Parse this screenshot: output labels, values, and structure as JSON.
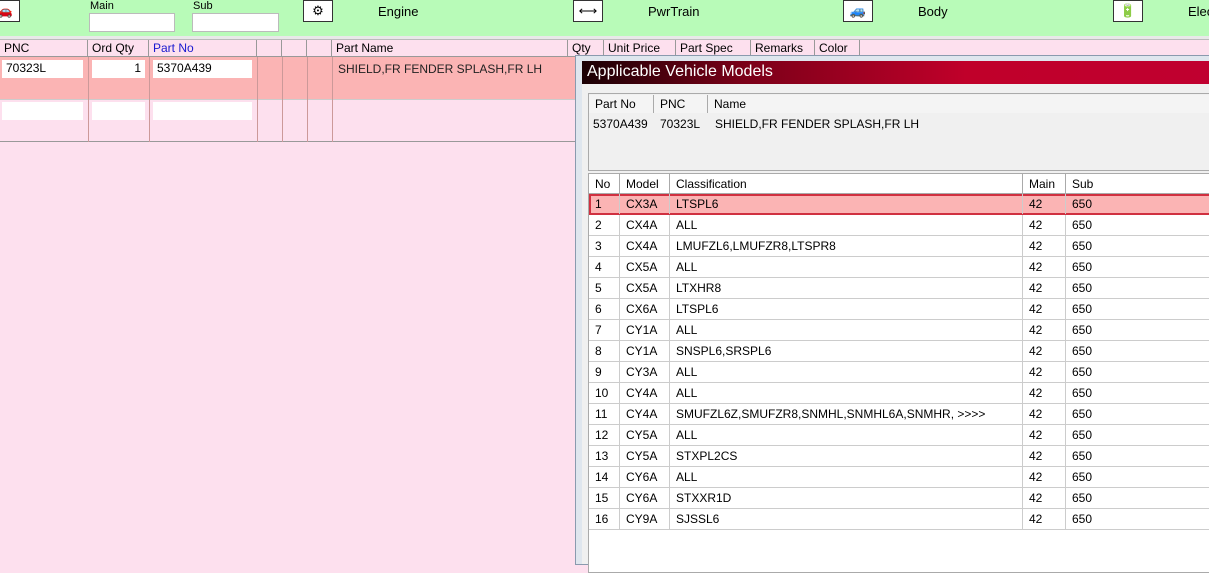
{
  "toolbar": {
    "main_label": "Main",
    "sub_label": "Sub",
    "main_value": "",
    "sub_value": "",
    "categories": [
      {
        "label": "Engine",
        "icon": "engine-icon"
      },
      {
        "label": "PwrTrain",
        "icon": "powertrain-icon"
      },
      {
        "label": "Body",
        "icon": "body-icon"
      },
      {
        "label": "Elec",
        "icon": "battery-icon"
      }
    ]
  },
  "grid": {
    "headers": [
      "PNC",
      "Ord Qty",
      "Part No",
      "",
      "",
      "",
      "Part Name",
      "Qty",
      "Unit Price",
      "Part Spec",
      "Remarks",
      "Color"
    ],
    "partno_header_color": "#1a1ad0",
    "rows": [
      {
        "pnc": "70323L",
        "ord_qty": "1",
        "part_no": "5370A439",
        "part_name": "SHIELD,FR FENDER SPLASH,FR LH"
      }
    ]
  },
  "dialog": {
    "title": "Applicable Vehicle Models",
    "part_headers": [
      "Part No",
      "PNC",
      "Name"
    ],
    "part": {
      "part_no": "5370A439",
      "pnc": "70323L",
      "name": "SHIELD,FR FENDER SPLASH,FR LH"
    },
    "list_headers": [
      "No",
      "Model",
      "Classification",
      "Main",
      "Sub"
    ],
    "selected_index": 0,
    "rows": [
      [
        "1",
        "CX3A",
        "LTSPL6",
        "42",
        "650"
      ],
      [
        "2",
        "CX4A",
        "ALL",
        "42",
        "650"
      ],
      [
        "3",
        "CX4A",
        "LMUFZL6,LMUFZR8,LTSPR8",
        "42",
        "650"
      ],
      [
        "4",
        "CX5A",
        "ALL",
        "42",
        "650"
      ],
      [
        "5",
        "CX5A",
        "LTXHR8",
        "42",
        "650"
      ],
      [
        "6",
        "CX6A",
        "LTSPL6",
        "42",
        "650"
      ],
      [
        "7",
        "CY1A",
        "ALL",
        "42",
        "650"
      ],
      [
        "8",
        "CY1A",
        "SNSPL6,SRSPL6",
        "42",
        "650"
      ],
      [
        "9",
        "CY3A",
        "ALL",
        "42",
        "650"
      ],
      [
        "10",
        "CY4A",
        "ALL",
        "42",
        "650"
      ],
      [
        "11",
        "CY4A",
        "SMUFZL6Z,SMUFZR8,SNMHL,SNMHL6A,SNMHR,  >>>>",
        "42",
        "650"
      ],
      [
        "12",
        "CY5A",
        "ALL",
        "42",
        "650"
      ],
      [
        "13",
        "CY5A",
        "STXPL2CS",
        "42",
        "650"
      ],
      [
        "14",
        "CY6A",
        "ALL",
        "42",
        "650"
      ],
      [
        "15",
        "CY6A",
        "STXXR1D",
        "42",
        "650"
      ],
      [
        "16",
        "CY9A",
        "SJSSL6",
        "42",
        "650"
      ]
    ]
  }
}
